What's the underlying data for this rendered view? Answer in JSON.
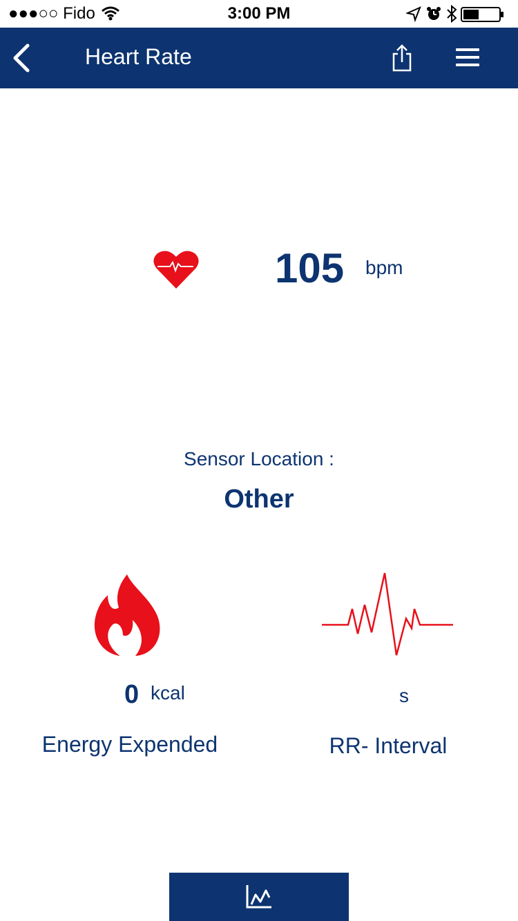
{
  "status_bar": {
    "carrier": "●●●○○ Fido",
    "time": "3:00 PM",
    "icons": [
      "wifi-icon",
      "location-icon",
      "alarm-icon",
      "bluetooth-icon",
      "battery-icon"
    ]
  },
  "nav": {
    "title": "Heart Rate",
    "icons": [
      "back-chevron-icon",
      "share-icon",
      "menu-icon"
    ]
  },
  "heart_rate": {
    "value": "105",
    "unit": "bpm"
  },
  "sensor": {
    "label": "Sensor Location :",
    "value": "Other"
  },
  "energy": {
    "value": "0",
    "unit": "kcal",
    "label": "Energy Expended"
  },
  "rr_interval": {
    "unit": "s",
    "label": "RR- Interval"
  },
  "bottom_button": {
    "icon": "line-chart-icon"
  },
  "colors": {
    "primary": "#0d3470",
    "accent_red": "#e8101a",
    "background": "#ffffff"
  }
}
